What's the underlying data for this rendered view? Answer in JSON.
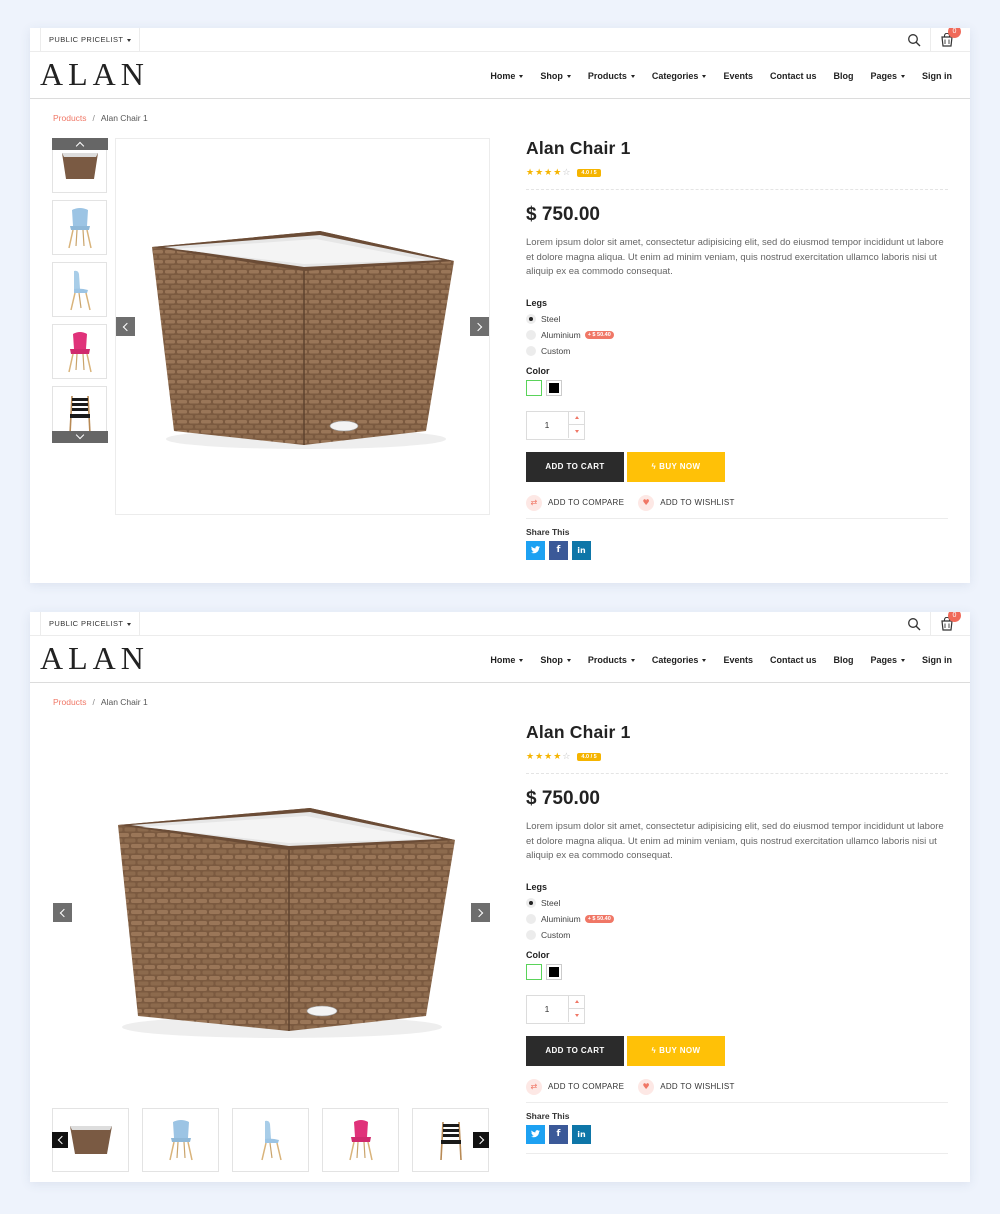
{
  "topbar": {
    "pricelist_label": "PUBLIC PRICELIST",
    "cart_count": "0"
  },
  "brand": {
    "logo_text": "ALAN"
  },
  "nav": {
    "home": "Home",
    "shop": "Shop",
    "products": "Products",
    "categories": "Categories",
    "events": "Events",
    "contact": "Contact us",
    "blog": "Blog",
    "pages": "Pages",
    "signin": "Sign in"
  },
  "breadcrumb": {
    "parent": "Products",
    "separator": "/",
    "current": "Alan Chair 1"
  },
  "product": {
    "title": "Alan Chair 1",
    "rating_value": 4,
    "rating_max": 5,
    "rating_badge": "4.0 / 5",
    "price": "$ 750.00",
    "description": "Lorem ipsum dolor sit amet, consectetur adipisicing elit, sed do eiusmod tempor incididunt ut labore et dolore magna aliqua. Ut enim ad minim veniam, quis nostrud exercitation ullamco laboris nisi ut aliquip ex ea commodo consequat."
  },
  "legs": {
    "label": "Legs",
    "options": [
      {
        "label": "Steel",
        "selected": true
      },
      {
        "label": "Aluminium",
        "extra": "+ $ 50.40"
      },
      {
        "label": "Custom"
      }
    ]
  },
  "color": {
    "label": "Color",
    "swatches": [
      "#ffffff",
      "#000000"
    ]
  },
  "quantity": {
    "value": "1"
  },
  "buttons": {
    "add_to_cart": "ADD TO CART",
    "buy_now": "BUY NOW"
  },
  "actions": {
    "compare": "ADD TO COMPARE",
    "wishlist": "ADD TO WISHLIST"
  },
  "share": {
    "label": "Share This",
    "networks": [
      "twitter",
      "facebook",
      "linkedin"
    ]
  },
  "colors": {
    "accent": "#f07766",
    "buy": "#ffc107",
    "dark": "#2b2b2b",
    "twitter": "#1da1f2",
    "facebook": "#3b5998",
    "linkedin": "#0e76a8"
  },
  "gallery_thumbnails": [
    "wicker-planter",
    "blue-chair-front",
    "blue-chair-side",
    "pink-chair",
    "black-strap-chair"
  ]
}
